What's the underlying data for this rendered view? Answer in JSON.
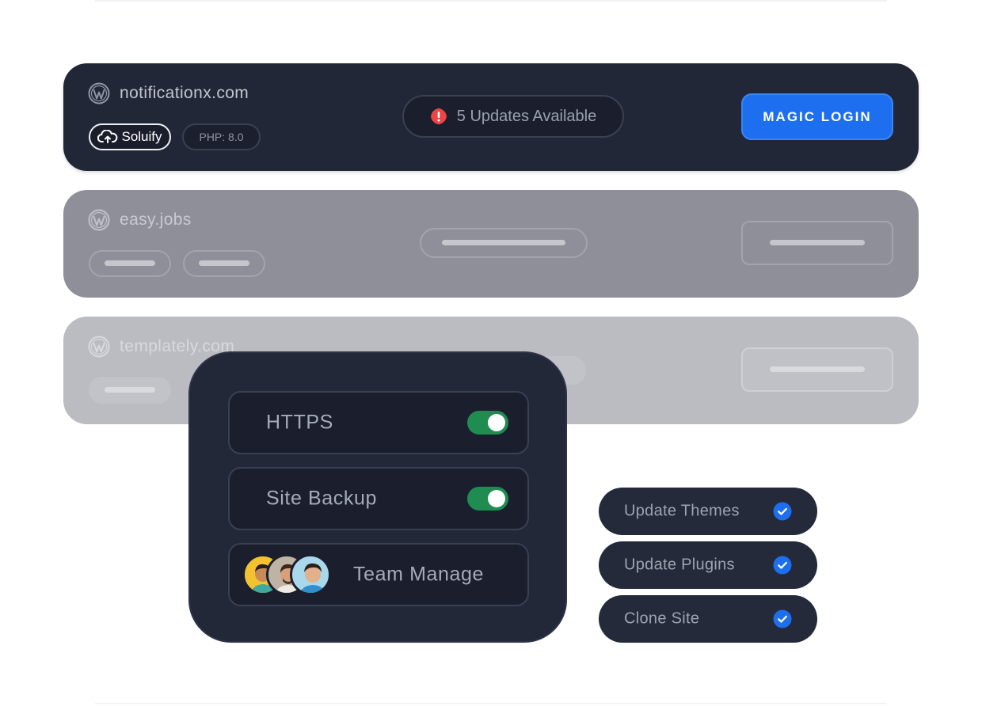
{
  "sites": [
    {
      "name": "notificationx.com",
      "provider_badge": "Soluify",
      "php_badge": "PHP: 8.0",
      "updates_label": "5 Updates Available",
      "action_label": "MAGIC LOGIN",
      "icon": "wordpress-icon",
      "alert_icon": "alert-icon"
    },
    {
      "name": "easy.jobs",
      "icon": "wordpress-icon"
    },
    {
      "name": "templately.com",
      "icon": "wordpress-icon"
    }
  ],
  "features": [
    {
      "label": "HTTPS",
      "enabled": true
    },
    {
      "label": "Site Backup",
      "enabled": true
    },
    {
      "label": "Team Manage",
      "avatars": [
        "avatar-1",
        "avatar-2",
        "avatar-3"
      ]
    }
  ],
  "checklist": [
    {
      "label": "Update Themes",
      "checked": true
    },
    {
      "label": "Update Plugins",
      "checked": true
    },
    {
      "label": "Clone Site",
      "checked": true
    }
  ],
  "colors": {
    "card_dark": "#222738",
    "accent_blue": "#1d6ff0",
    "toggle_green": "#1f8c52",
    "alert_red": "#f04444"
  }
}
